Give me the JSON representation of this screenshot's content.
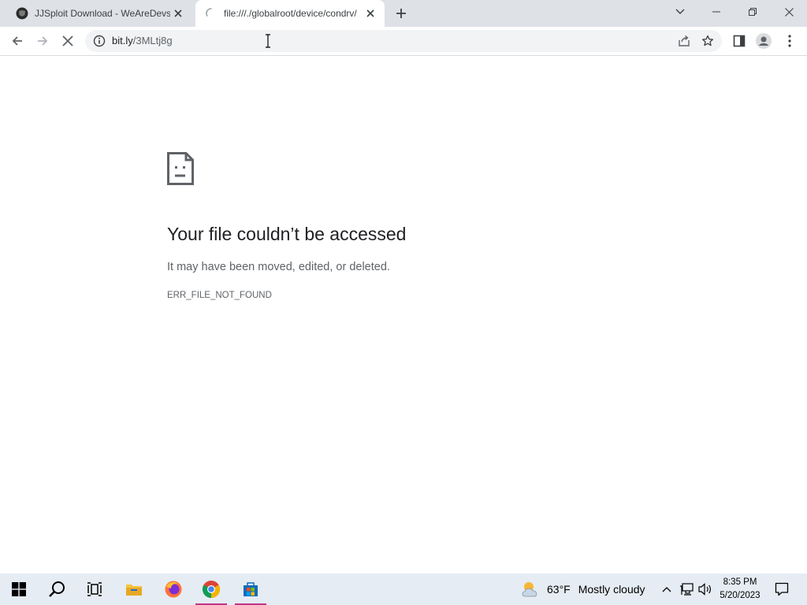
{
  "browser": {
    "tabs": [
      {
        "title": "JJSploit Download - WeAreDevs",
        "active": false,
        "loading": false
      },
      {
        "title": "file:///./globalroot/device/condrv/",
        "active": true,
        "loading": true
      }
    ],
    "address": {
      "host": "bit.ly",
      "path": "/3MLtj8g"
    }
  },
  "error_page": {
    "title": "Your file couldn’t be accessed",
    "description": "It may have been moved, edited, or deleted.",
    "code": "ERR_FILE_NOT_FOUND"
  },
  "taskbar": {
    "pinned": [
      "windows-start",
      "search",
      "task-view",
      "file-explorer",
      "firefox",
      "chrome",
      "microsoft-store"
    ],
    "weather": {
      "temp": "63°F",
      "condition": "Mostly cloudy"
    },
    "clock": {
      "time": "8:35 PM",
      "date": "5/20/2023"
    }
  },
  "colors": {
    "tabstrip": "#dee1e6",
    "omnibox": "#f1f3f4",
    "taskbar": "#e5ecf3",
    "accent": "#1a73e8"
  }
}
